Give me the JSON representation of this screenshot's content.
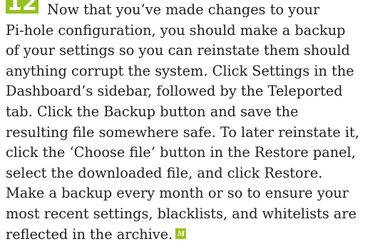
{
  "step": {
    "number": "12"
  },
  "body": {
    "lines": [
      "Now that you’ve made changes to your",
      "Pi-hole configuration, you should make a backup",
      "of your settings so you can reinstate them should",
      "anything corrupt the system. Click Settings in the",
      "Dashboard’s sidebar, followed by the Teleported",
      "tab. Click the Backup button and save the",
      "resulting file somewhere safe. To later reinstate it,",
      "click the ‘Choose file’ button in the Restore panel,",
      "select the downloaded file, and click Restore.",
      "Make a backup every month or so to ensure your",
      "most recent settings, blacklists, and whitelists are",
      "reflected in the archive."
    ]
  },
  "end_mark": {
    "label": "M"
  },
  "colors": {
    "accent": "#96c11f",
    "text": "#1e1e1e",
    "background": "#ffffff"
  }
}
